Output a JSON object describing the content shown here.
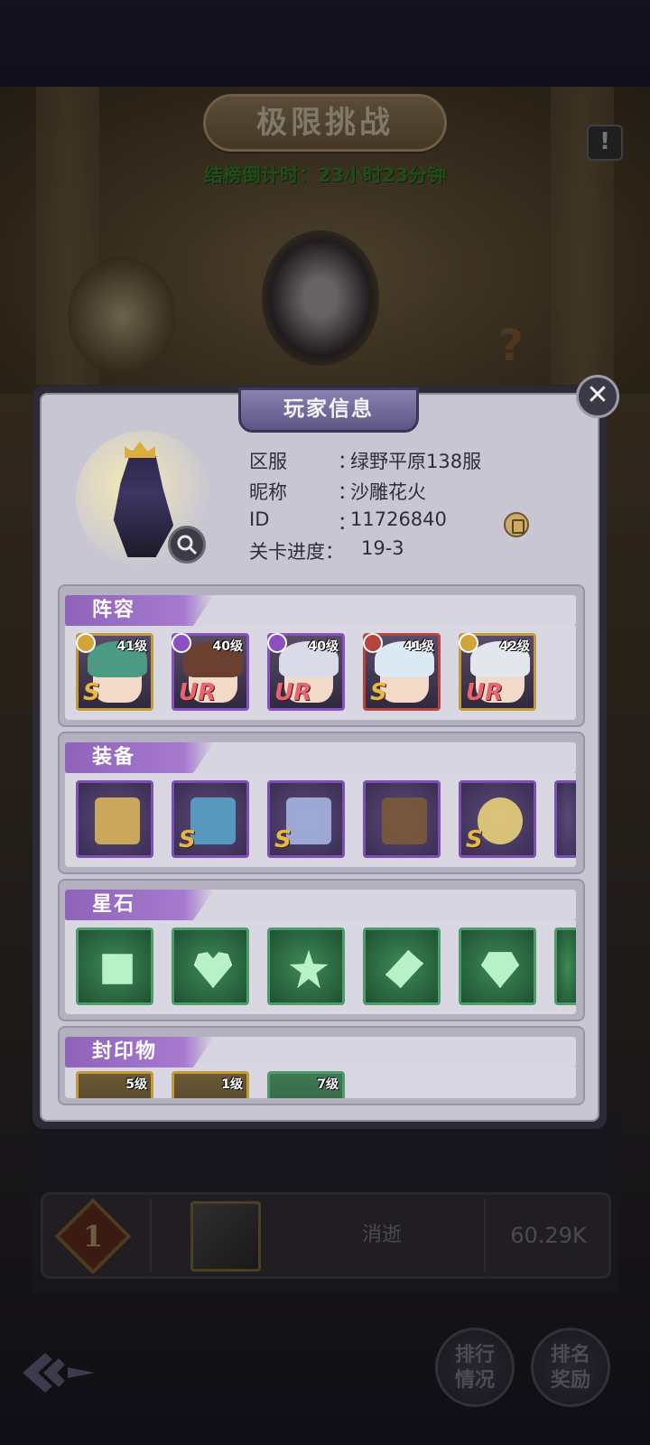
{
  "screen": {
    "title": "极限挑战",
    "countdown": "结榜倒计时：23小时23分钟",
    "alert_icon": "!",
    "help_icon": "?",
    "back_icon": "◆"
  },
  "ranking": {
    "rank": "1",
    "name": "消逝",
    "score": "60.29K"
  },
  "bottom_buttons": {
    "ranking_status": "排行\n情况",
    "ranking_rewards": "排名\n奖励"
  },
  "modal": {
    "title": "玩家信息",
    "close_icon": "✕",
    "info": [
      {
        "label": "区服",
        "sep": "：",
        "value": "绿野平原138服"
      },
      {
        "label": "昵称",
        "sep": "：",
        "value": "沙雕花火"
      },
      {
        "label": "ID",
        "sep": "：",
        "value": "11726840"
      },
      {
        "label": "关卡进度：",
        "sep": "",
        "value": "19-3"
      }
    ],
    "sections": {
      "lineup": {
        "title": "阵容",
        "heroes": [
          {
            "level": "41级",
            "grade": "S",
            "frame": "gold",
            "hair": "#4a9a84",
            "class_color": "#d2a43a"
          },
          {
            "level": "40级",
            "grade": "UR",
            "frame": "purple",
            "hair": "#6b4030",
            "class_color": "#8b4fc2"
          },
          {
            "level": "40级",
            "grade": "UR",
            "frame": "purple",
            "hair": "#d9dce8",
            "class_color": "#8b4fc2"
          },
          {
            "level": "41级",
            "grade": "S",
            "frame": "red",
            "hair": "#dbe9f4",
            "class_color": "#b5443f"
          },
          {
            "level": "42级",
            "grade": "UR",
            "frame": "gold",
            "hair": "#e4e6ee",
            "class_color": "#d2a43a"
          }
        ]
      },
      "equipment": {
        "title": "装备",
        "items": [
          {
            "name": "staff",
            "grade": "",
            "color": "#d7b45a"
          },
          {
            "name": "book",
            "grade": "S",
            "color": "#5aa2c8"
          },
          {
            "name": "crown",
            "grade": "S",
            "color": "#a6b4e0"
          },
          {
            "name": "cloak",
            "grade": "",
            "color": "#7a5a3a"
          },
          {
            "name": "ring",
            "grade": "S",
            "color": "#e8cf7a"
          }
        ]
      },
      "starstones": {
        "title": "星石",
        "gems": [
          "square",
          "heart",
          "star",
          "diamond",
          "shield"
        ]
      },
      "seals": {
        "title": "封印物",
        "items": [
          {
            "level": "5级"
          },
          {
            "level": "1级"
          },
          {
            "level": "7级"
          }
        ]
      }
    }
  }
}
